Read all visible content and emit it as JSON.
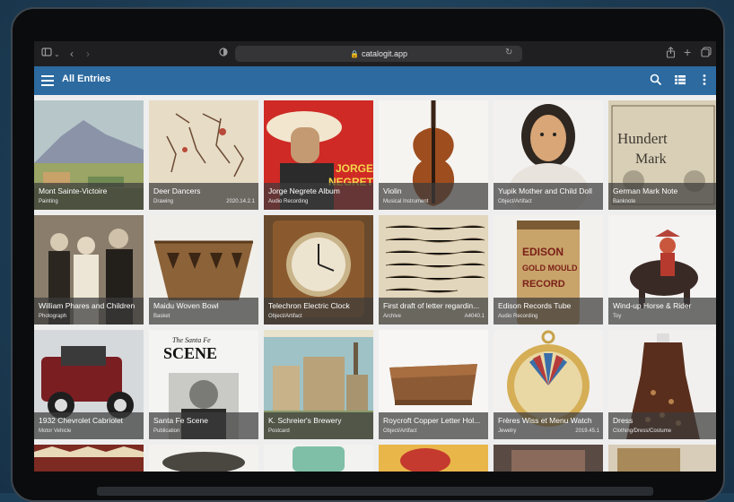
{
  "browser": {
    "url": "catalogit.app"
  },
  "appbar": {
    "title": "All Entries",
    "accent": "#2c6aa0"
  },
  "icons": [
    "sidebar-icon",
    "chevron-down-icon",
    "back-icon",
    "forward-icon",
    "shield-icon",
    "lock-icon",
    "reload-icon",
    "share-icon",
    "plus-icon",
    "tabs-icon",
    "menu-icon",
    "search-icon",
    "list-view-icon",
    "more-icon",
    "add-icon"
  ],
  "entries": [
    {
      "name": "Mont Sainte-Victoire",
      "type": "Painting",
      "code": ""
    },
    {
      "name": "Deer Dancers",
      "type": "Drawing",
      "code": "2020.14.2.1"
    },
    {
      "name": "Jorge Negrete Album",
      "type": "Audio Recording",
      "code": ""
    },
    {
      "name": "Violin",
      "type": "Musical Instrument",
      "code": ""
    },
    {
      "name": "Yupik Mother and Child Doll",
      "type": "Object/Artifact",
      "code": ""
    },
    {
      "name": "German Mark Note",
      "type": "Banknote",
      "code": ""
    },
    {
      "name": "William Phares and Children",
      "type": "Photograph",
      "code": ""
    },
    {
      "name": "Maidu Woven Bowl",
      "type": "Basket",
      "code": ""
    },
    {
      "name": "Telechron Electric Clock",
      "type": "Object/Artifact",
      "code": ""
    },
    {
      "name": "First draft of letter regardin...",
      "type": "Archive",
      "code": "A4040.1"
    },
    {
      "name": "Edison Records Tube",
      "type": "Audio Recording",
      "code": ""
    },
    {
      "name": "Wind-up Horse & Rider",
      "type": "Toy",
      "code": ""
    },
    {
      "name": "1932 Chevrolet Cabriolet",
      "type": "Motor Vehicle",
      "code": ""
    },
    {
      "name": "Santa Fe Scene",
      "type": "Publication",
      "code": ""
    },
    {
      "name": "K. Schreier's Brewery",
      "type": "Postcard",
      "code": ""
    },
    {
      "name": "Roycroft Copper Letter Hol...",
      "type": "Object/Artifact",
      "code": ""
    },
    {
      "name": "Frères Wiss et Menu Watch",
      "type": "Jewelry",
      "code": "2019.45.1"
    },
    {
      "name": "Dress",
      "type": "Clothing/Dress/Costume",
      "code": ""
    }
  ],
  "fab": {
    "label": "+",
    "color": "#f08a24"
  }
}
